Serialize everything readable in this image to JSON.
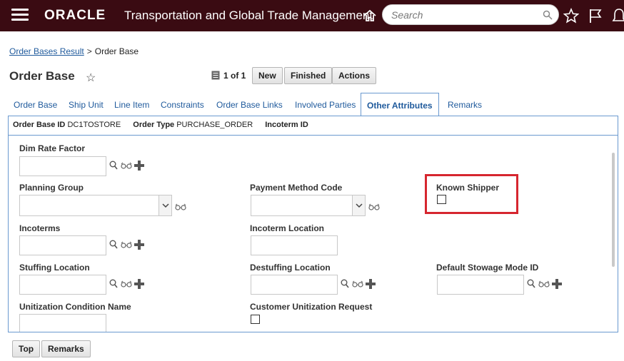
{
  "header": {
    "brand": "ORACLE",
    "app_title": "Transportation and Global Trade Management",
    "search_placeholder": "Search"
  },
  "breadcrumb": {
    "link": "Order Bases Result",
    "separator": ">",
    "current": "Order Base"
  },
  "page": {
    "title": "Order Base",
    "record_count": "1 of 1"
  },
  "toolbar": {
    "new_label": "New",
    "finished_label": "Finished",
    "actions_label": "Actions"
  },
  "tabs": [
    {
      "label": "Order Base"
    },
    {
      "label": "Ship Unit"
    },
    {
      "label": "Line Item"
    },
    {
      "label": "Constraints"
    },
    {
      "label": "Order Base Links"
    },
    {
      "label": "Involved Parties"
    },
    {
      "label": "Other Attributes",
      "active": true
    },
    {
      "label": "Remarks"
    }
  ],
  "info": {
    "order_base_id_label": "Order Base ID",
    "order_base_id_value": "DC1TOSTORE",
    "order_type_label": "Order Type",
    "order_type_value": "PURCHASE_ORDER",
    "incoterm_id_label": "Incoterm ID"
  },
  "fields": {
    "dim_rate_factor": {
      "label": "Dim Rate Factor",
      "value": ""
    },
    "planning_group": {
      "label": "Planning Group",
      "value": ""
    },
    "payment_method_code": {
      "label": "Payment Method Code",
      "value": ""
    },
    "known_shipper": {
      "label": "Known Shipper",
      "checked": false
    },
    "incoterms": {
      "label": "Incoterms",
      "value": ""
    },
    "incoterm_location": {
      "label": "Incoterm Location",
      "value": ""
    },
    "stuffing_location": {
      "label": "Stuffing Location",
      "value": ""
    },
    "destuffing_location": {
      "label": "Destuffing Location",
      "value": ""
    },
    "default_stowage_mode_id": {
      "label": "Default Stowage Mode ID",
      "value": ""
    },
    "unitization_condition_name": {
      "label": "Unitization Condition Name",
      "value": ""
    },
    "customer_unitization_request": {
      "label": "Customer Unitization Request",
      "checked": false
    }
  },
  "footer": {
    "top_label": "Top",
    "remarks_label": "Remarks"
  },
  "colors": {
    "header_bg": "#3a0b12",
    "link": "#1f5a9c",
    "panel_border": "#6a99cf",
    "highlight": "#d6262f"
  },
  "icons": [
    "hamburger-icon",
    "home-icon",
    "search-icon",
    "star-icon",
    "flag-icon",
    "bell-icon",
    "record-icon",
    "magnifier-icon",
    "glasses-icon",
    "plus-icon",
    "chevron-down-icon"
  ]
}
